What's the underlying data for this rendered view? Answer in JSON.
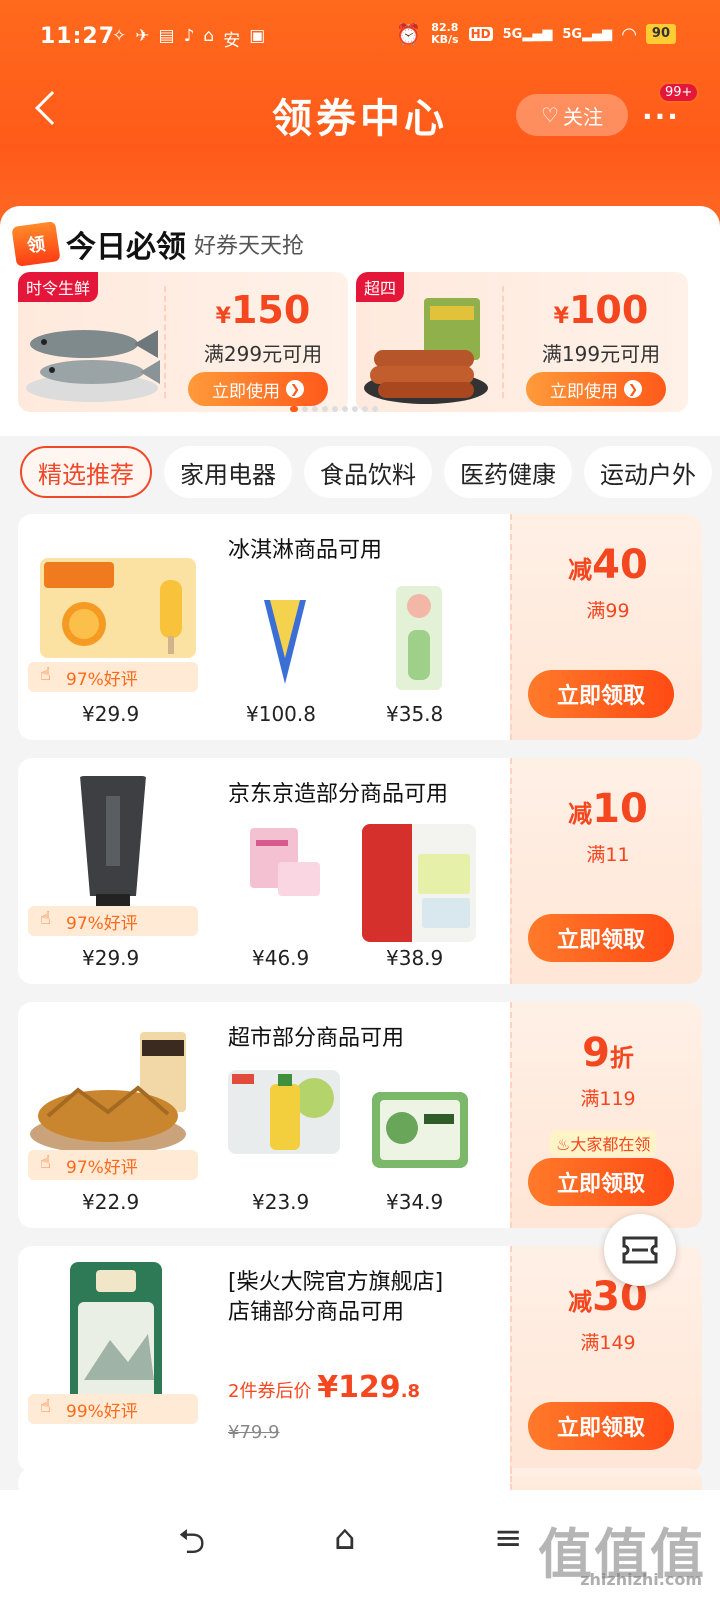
{
  "status": {
    "time": "11:27",
    "speed_top": "82.8",
    "speed_unit": "KB/s",
    "net1": "5G",
    "net2": "5G",
    "battery": "90",
    "icons": [
      "link-icon",
      "bird-icon",
      "card-icon",
      "tiktok-icon",
      "home-app-icon",
      "an-app-icon",
      "youku-icon"
    ]
  },
  "header": {
    "title": "领券中心",
    "follow_label": "关注",
    "more_label": "···",
    "badge": "99+"
  },
  "today": {
    "icon_text": "领",
    "title": "今日必领",
    "subtitle": "好券天天抢",
    "coupons": [
      {
        "tag": "时令生鲜",
        "yen": "¥",
        "amount": "150",
        "condition": "满299元可用",
        "button": "立即使用"
      },
      {
        "tag": "超四",
        "yen": "¥",
        "amount": "100",
        "condition": "满199元可用",
        "button": "立即使用"
      }
    ],
    "page_dots": 9,
    "active_dot": 0
  },
  "tabs": [
    "精选推荐",
    "家用电器",
    "食品饮料",
    "医药健康",
    "运动户外"
  ],
  "coupons": [
    {
      "title": "冰淇淋商品可用",
      "rating": "97%好评",
      "prices": [
        "¥29.9",
        "¥100.8",
        "¥35.8"
      ],
      "prefix": "减",
      "value": "40",
      "threshold": "满99",
      "button": "立即领取"
    },
    {
      "title": "京东京造部分商品可用",
      "rating": "97%好评",
      "prices": [
        "¥29.9",
        "¥46.9",
        "¥38.9"
      ],
      "prefix": "减",
      "value": "10",
      "threshold": "满11",
      "button": "立即领取"
    },
    {
      "title": "超市部分商品可用",
      "rating": "97%好评",
      "prices": [
        "¥22.9",
        "¥23.9",
        "¥34.9"
      ],
      "prefix": "",
      "value": "9",
      "suffix": "折",
      "threshold": "满119",
      "hot": "大家都在领",
      "button": "立即领取"
    },
    {
      "title_line1": "[柴火大院官方旗舰店]",
      "title_line2": "店铺部分商品可用",
      "rating": "99%好评",
      "after_label": "2件券后价",
      "after_yen": "¥",
      "after_int": "129",
      "after_dec": ".8",
      "orig_price": "¥79.9",
      "prefix": "减",
      "value": "30",
      "threshold": "满149",
      "button": "立即领取"
    }
  ],
  "watermark": {
    "main": "值值值",
    "site": "zhizhizhi.com"
  },
  "colors": {
    "brand": "#ff5a1a",
    "accent": "#f4471f",
    "badge": "#e4173a"
  }
}
